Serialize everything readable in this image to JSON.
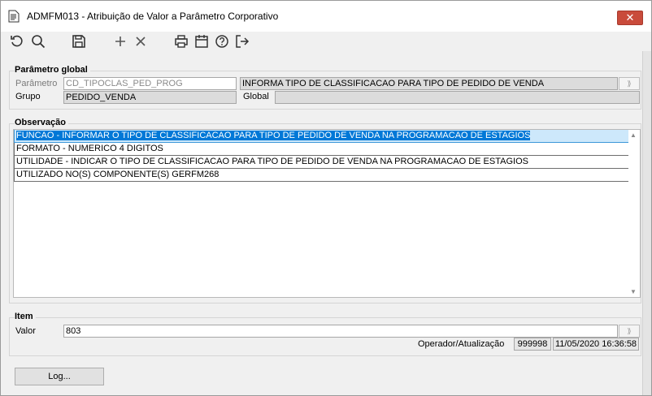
{
  "window": {
    "title": "ADMFM013 - Atribuição de Valor a Parâmetro Corporativo",
    "close_label": "✕"
  },
  "toolbar": {
    "icons": [
      "refresh-icon",
      "search-icon",
      "save-icon",
      "add-icon",
      "delete-icon",
      "print-icon",
      "calendar-icon",
      "help-icon",
      "exit-icon"
    ]
  },
  "parametro_global": {
    "legend": "Parâmetro global",
    "parametro_label": "Parâmetro",
    "parametro_value": "CD_TIPOCLAS_PED_PROG",
    "descricao_value": "INFORMA TIPO DE CLASSIFICACAO PARA TIPO DE PEDIDO DE VENDA",
    "grupo_label": "Grupo",
    "grupo_value": "PEDIDO_VENDA",
    "global_label": "Global",
    "global_value": ""
  },
  "observacao": {
    "legend": "Observação",
    "rows": [
      "FUNCAO - INFORMAR O TIPO DE CLASSIFICACAO PARA TIPO DE PEDIDO DE VENDA NA PROGRAMACAO DE ESTAGIOS",
      "FORMATO - NUMERICO 4 DIGITOS",
      "UTILIDADE - INDICAR O TIPO DE CLASSIFICACAO PARA TIPO DE PEDIDO DE VENDA NA PROGRAMACAO DE ESTAGIOS",
      "UTILIZADO NO(S) COMPONENTE(S) GERFM268"
    ]
  },
  "item": {
    "legend": "Item",
    "valor_label": "Valor",
    "valor_value": "803",
    "operador_label": "Operador/Atualização",
    "operador_value": "999998",
    "atualizacao_value": "11/05/2020 16:36:58"
  },
  "footer": {
    "log_label": "Log..."
  }
}
